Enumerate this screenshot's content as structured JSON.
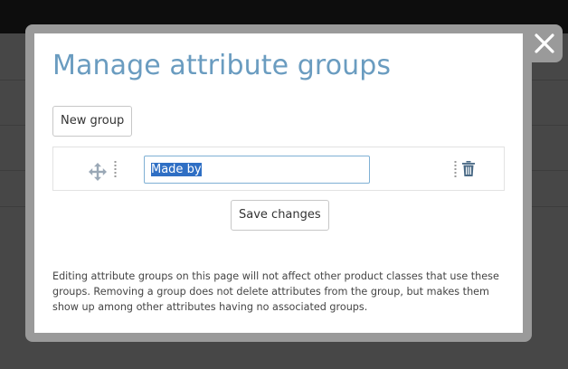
{
  "modal": {
    "title": "Manage attribute groups",
    "new_group_label": "New group",
    "groups": [
      {
        "name": "Made by"
      }
    ],
    "save_label": "Save changes",
    "note": "Editing attribute groups on this page will not affect other product classes that use these groups. Removing a group does not delete attributes from the group, but makes them show up among other attributes having no associated groups."
  },
  "icons": {
    "close": "close-icon",
    "move": "move-arrows-icon",
    "drag": "drag-handle-icon",
    "delete": "trash-icon"
  },
  "colors": {
    "title": "#6a9cc0",
    "input_border": "#7fb0d4",
    "selection": "#2f6fc4",
    "overlay": "#000000"
  }
}
